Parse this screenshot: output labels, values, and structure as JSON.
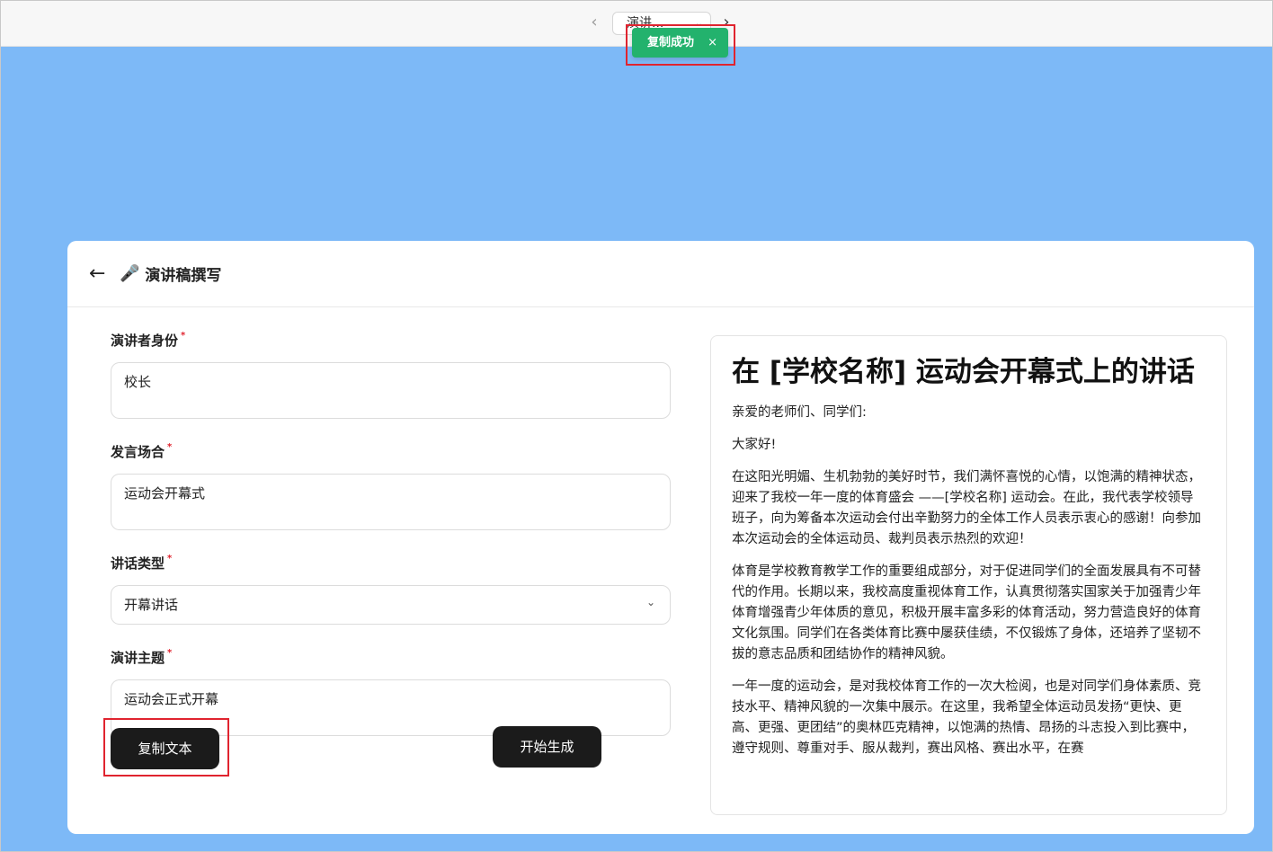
{
  "topbar": {
    "prev_icon": "chevron-left-icon",
    "next_icon": "chevron-right-icon",
    "tab_label": "演讲..."
  },
  "toast": {
    "message": "复制成功",
    "close": "×",
    "color": "#23b26d"
  },
  "header": {
    "title": "演讲稿撰写",
    "back_icon": "arrow-left-icon",
    "mic_icon": "microphone-icon"
  },
  "form": {
    "speaker": {
      "label": "演讲者身份",
      "required": "*",
      "value": "校长"
    },
    "occasion": {
      "label": "发言场合",
      "required": "*",
      "value": "运动会开幕式"
    },
    "speech_type": {
      "label": "讲话类型",
      "required": "*",
      "value": "开幕讲话"
    },
    "topic": {
      "label": "演讲主题",
      "required": "*",
      "value": "运动会正式开幕"
    }
  },
  "buttons": {
    "copy": "复制文本",
    "generate": "开始生成"
  },
  "preview": {
    "title": "在 [学校名称] 运动会开幕式上的讲话",
    "paragraphs": [
      "亲爱的老师们、同学们:",
      "大家好!",
      "在这阳光明媚、生机勃勃的美好时节，我们满怀喜悦的心情，以饱满的精神状态，迎来了我校一年一度的体育盛会 ——[学校名称] 运动会。在此，我代表学校领导班子，向为筹备本次运动会付出辛勤努力的全体工作人员表示衷心的感谢！向参加本次运动会的全体运动员、裁判员表示热烈的欢迎！",
      "体育是学校教育教学工作的重要组成部分，对于促进同学们的全面发展具有不可替代的作用。长期以来，我校高度重视体育工作，认真贯彻落实国家关于加强青少年体育增强青少年体质的意见，积极开展丰富多彩的体育活动，努力营造良好的体育文化氛围。同学们在各类体育比赛中屡获佳绩，不仅锻炼了身体，还培养了坚韧不拔的意志品质和团结协作的精神风貌。",
      "一年一度的运动会，是对我校体育工作的一次大检阅，也是对同学们身体素质、竞技水平、精神风貌的一次集中展示。在这里，我希望全体运动员发扬“更快、更高、更强、更团结”的奥林匹克精神，以饱满的热情、昂扬的斗志投入到比赛中，遵守规则、尊重对手、服从裁判，赛出风格、赛出水平，在赛"
    ]
  }
}
